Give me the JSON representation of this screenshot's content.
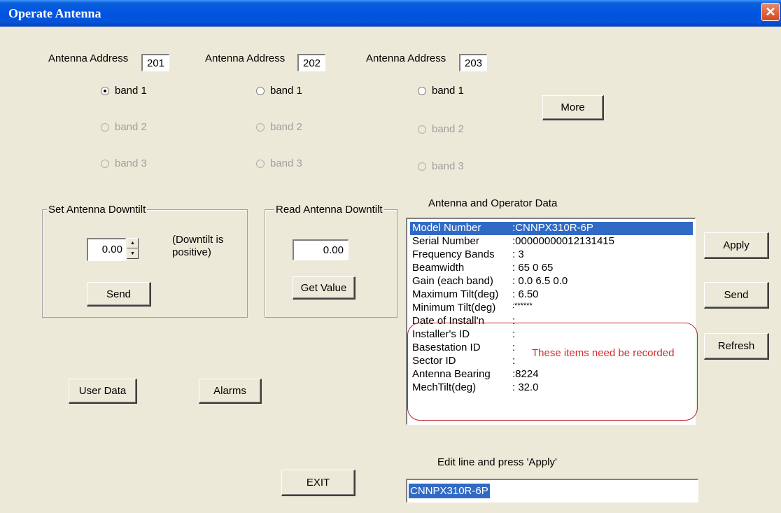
{
  "window": {
    "title": "Operate Antenna",
    "close_glyph": "✕"
  },
  "antennas": [
    {
      "label": "Antenna Address",
      "address": "201",
      "bands": [
        "band 1",
        "band 2",
        "band 3"
      ]
    },
    {
      "label": "Antenna Address",
      "address": "202",
      "bands": [
        "band 1",
        "band 2",
        "band 3"
      ]
    },
    {
      "label": "Antenna Address",
      "address": "203",
      "bands": [
        "band 1",
        "band 2",
        "band 3"
      ]
    }
  ],
  "more_label": "More",
  "set_group": {
    "title": "Set Antenna Downtilt",
    "value": "0.00",
    "hint_line1": "(Downtilt is",
    "hint_line2": "positive)",
    "send_label": "Send"
  },
  "read_group": {
    "title": "Read Antenna Downtilt",
    "value": "0.00",
    "get_label": "Get Value"
  },
  "user_data_label": "User Data",
  "alarms_label": "Alarms",
  "data_panel": {
    "title": "Antenna and Operator Data",
    "rows": [
      {
        "key": "Model Number",
        "value": ":CNNPX310R-6P"
      },
      {
        "key": "Serial Number",
        "value": ":00000000012131415"
      },
      {
        "key": "Frequency Bands",
        "value": ":  3"
      },
      {
        "key": "Beamwidth",
        "value": ":  65  0  65"
      },
      {
        "key": "Gain (each band)",
        "value": ":  0.0     6.5     0.0"
      },
      {
        "key": "Maximum Tilt(deg)",
        "value": ":  6.50"
      },
      {
        "key": "Minimum Tilt(deg)",
        "value": ":******"
      },
      {
        "key": "Date of Install'n",
        "value": ":"
      },
      {
        "key": "Installer's ID",
        "value": ":"
      },
      {
        "key": "Basestation ID",
        "value": ":"
      },
      {
        "key": "Sector ID",
        "value": ":"
      },
      {
        "key": "Antenna Bearing",
        "value": ":8224"
      },
      {
        "key": "MechTilt(deg)",
        "value": ":   32.0"
      }
    ],
    "note": "These items need be recorded",
    "red_color": "#c0282d"
  },
  "side_buttons": {
    "apply": "Apply",
    "send": "Send",
    "refresh": "Refresh"
  },
  "edit": {
    "label": "Edit line and press 'Apply'",
    "value": "CNNPX310R-6P"
  },
  "exit_label": "EXIT",
  "icons": {
    "spin_up": "▲",
    "spin_down": "▼"
  }
}
